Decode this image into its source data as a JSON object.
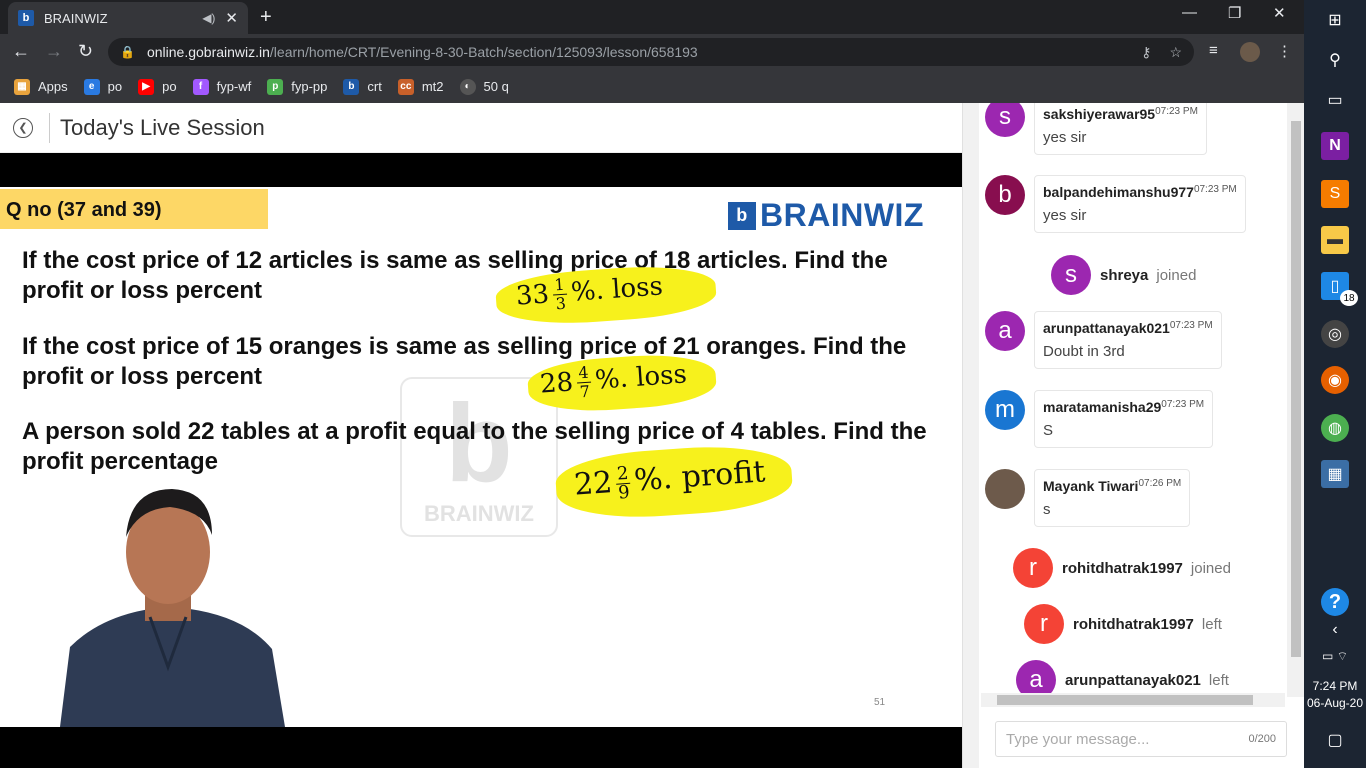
{
  "browser": {
    "tab_title": "BRAINWIZ",
    "url_host": "online.gobrainwiz.in",
    "url_path": "/learn/home/CRT/Evening-8-30-Batch/section/125093/lesson/658193",
    "bookmarks": [
      {
        "label": "Apps",
        "color": "#e8a33d"
      },
      {
        "label": "po",
        "color": "#2a7ae2"
      },
      {
        "label": "po",
        "color": "#ff0000"
      },
      {
        "label": "fyp-wf",
        "color": "#a259ff"
      },
      {
        "label": "fyp-pp",
        "color": "#4caf50"
      },
      {
        "label": "crt",
        "color": "#1e5aa8"
      },
      {
        "label": "mt2",
        "color": "#c8602a"
      },
      {
        "label": "50 q",
        "color": "#555"
      }
    ]
  },
  "page": {
    "title": "Today's Live Session"
  },
  "slide": {
    "banner": "Q no (37 and 39)",
    "brand": "BRAINWIZ",
    "questions": [
      {
        "line1": "If the cost price of 12 articles is same as selling price of 18 articles. Find the",
        "line2": "profit or loss percent"
      },
      {
        "line1": "If the cost price of 15 oranges is same as selling price of 21 oranges. Find the",
        "line2": "profit or loss percent"
      },
      {
        "line1": "A person sold 22 tables at a profit equal to the selling price of 4 tables. Find the",
        "line2": "profit percentage"
      }
    ],
    "answers": [
      {
        "whole": "33",
        "num": "1",
        "den": "3",
        "suffix": "%. loss"
      },
      {
        "whole": "28",
        "num": "4",
        "den": "7",
        "suffix": "%. loss"
      },
      {
        "whole": "22",
        "num": "2",
        "den": "9",
        "suffix": "%. profit"
      }
    ],
    "watermark": "BRAINWIZ",
    "slide_number": "51"
  },
  "chat": {
    "messages": [
      {
        "user": "sakshiyerawar95",
        "time": "07:23 PM",
        "text": "yes sir",
        "initial": "s",
        "color": "#9c27b0"
      },
      {
        "user": "balpandehimanshu977",
        "time": "07:23 PM",
        "text": "yes sir",
        "initial": "b",
        "color": "#880e4f"
      },
      {
        "user": "arunpattanayak021",
        "time": "07:23 PM",
        "text": "Doubt in 3rd",
        "initial": "a",
        "color": "#9c27b0"
      },
      {
        "user": "maratamanisha29",
        "time": "07:23 PM",
        "text": "S",
        "initial": "m",
        "color": "#1976d2"
      },
      {
        "user": "Mayank Tiwari",
        "time": "07:26 PM",
        "text": "s",
        "initial": "",
        "color": "#6d5a4b"
      }
    ],
    "events": [
      {
        "user": "shreya",
        "status": "joined",
        "initial": "s",
        "color": "#9c27b0"
      },
      {
        "user": "rohitdhatrak1997",
        "status": "joined",
        "initial": "r",
        "color": "#f44336"
      },
      {
        "user": "rohitdhatrak1997",
        "status": "left",
        "initial": "r",
        "color": "#f44336"
      },
      {
        "user": "arunpattanayak021",
        "status": "left",
        "initial": "a",
        "color": "#9c27b0"
      }
    ],
    "input_placeholder": "Type your message...",
    "char_count": "0/200"
  },
  "taskbar": {
    "time": "7:24 PM",
    "date": "06-Aug-20",
    "badge": "18"
  }
}
